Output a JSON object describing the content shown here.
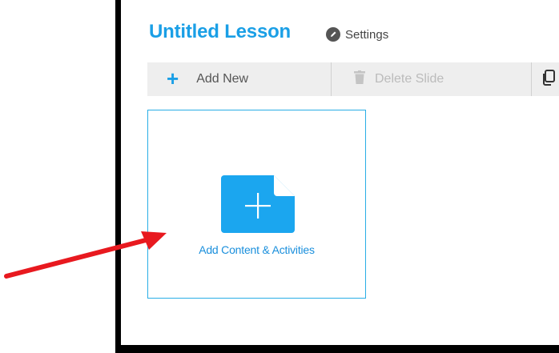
{
  "lesson": {
    "title": "Untitled Lesson",
    "settings_label": "Settings"
  },
  "toolbar": {
    "add_new_label": "Add New",
    "delete_slide_label": "Delete Slide"
  },
  "slide_card": {
    "label": "Add Content & Activities"
  },
  "icons": {
    "settings": "pencil-icon",
    "add_new": "plus-icon",
    "delete_slide": "trash-icon",
    "duplicate": "copy-icon",
    "add_content": "add-document-icon",
    "annotation": "red-arrow"
  },
  "colors": {
    "accent": "#1a9fe6",
    "card_border": "#29aee6",
    "toolbar_bg": "#eeeeee",
    "annotation_arrow": "#e8191f",
    "frame_border": "#000000"
  }
}
